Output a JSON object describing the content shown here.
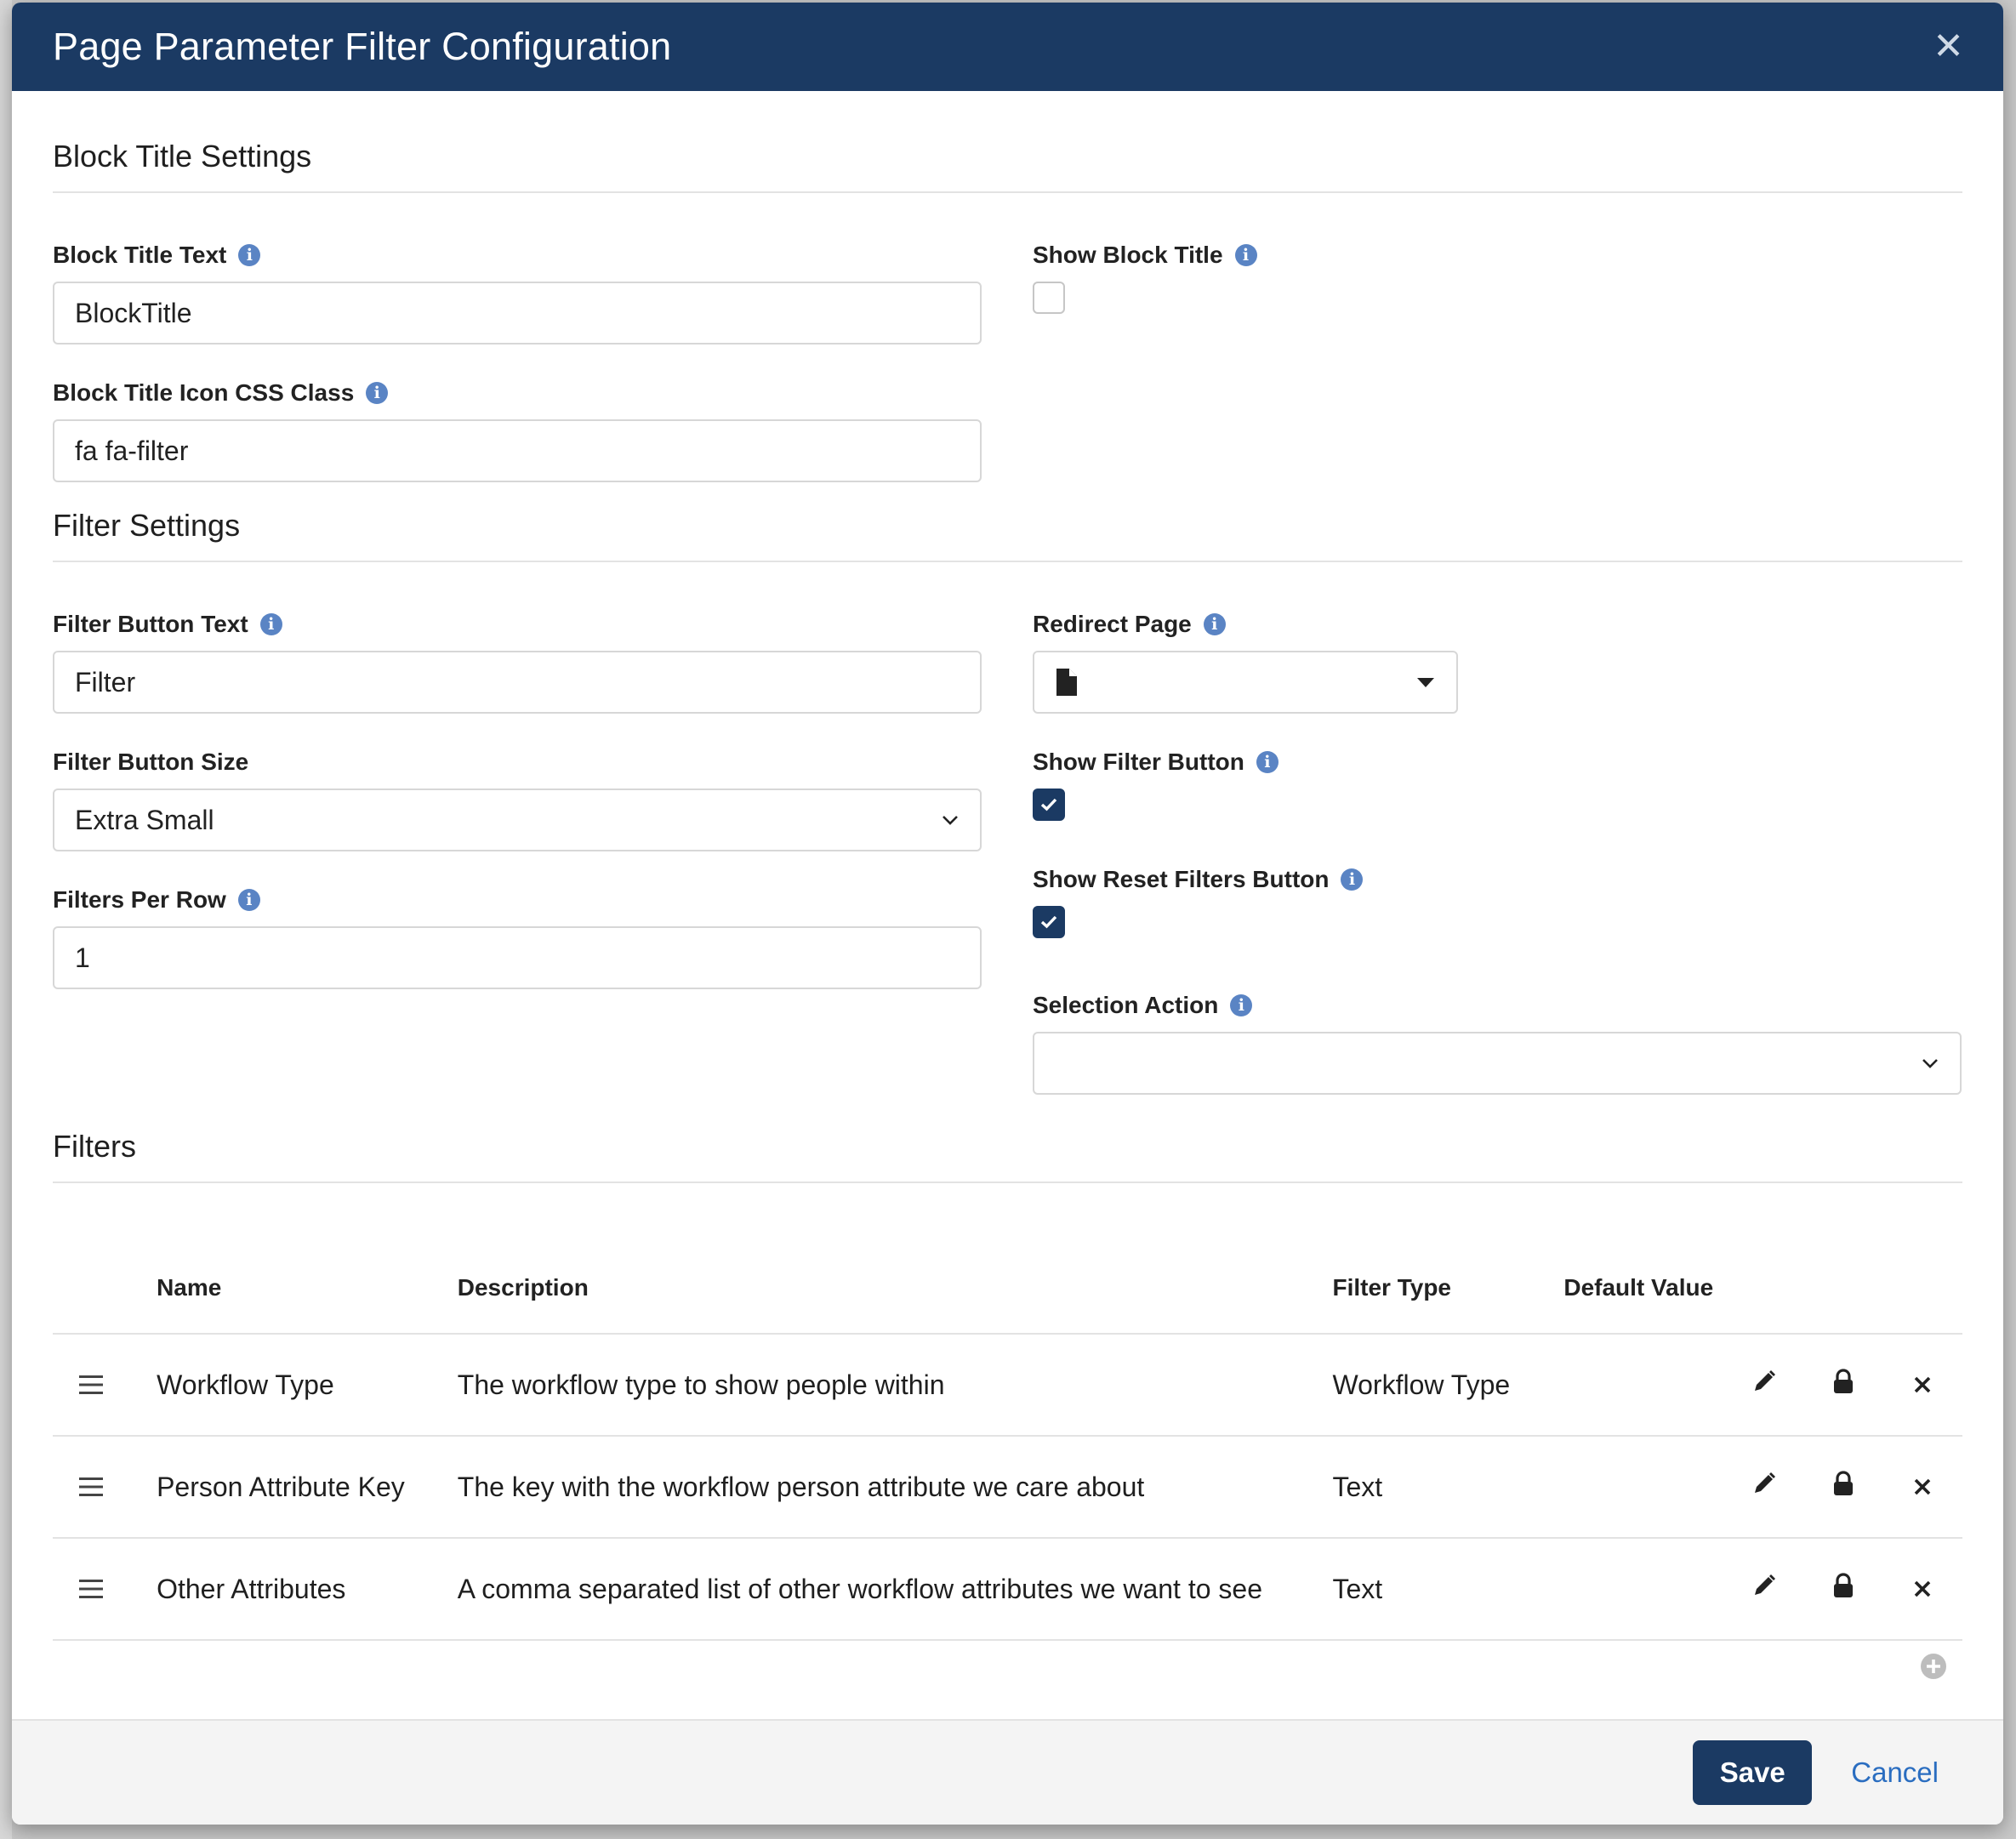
{
  "modal": {
    "title": "Page Parameter Filter Configuration",
    "close_icon": "close-icon"
  },
  "block_title_section": {
    "heading": "Block Title Settings",
    "title_text": {
      "label": "Block Title Text",
      "value": "BlockTitle"
    },
    "show_title": {
      "label": "Show Block Title",
      "checked": false
    },
    "icon_css": {
      "label": "Block Title Icon CSS Class",
      "value": "fa fa-filter"
    }
  },
  "filter_settings": {
    "heading": "Filter Settings",
    "button_text": {
      "label": "Filter Button Text",
      "value": "Filter"
    },
    "redirect_page": {
      "label": "Redirect Page",
      "value": ""
    },
    "button_size": {
      "label": "Filter Button Size",
      "value": "Extra Small"
    },
    "show_filter_button": {
      "label": "Show Filter Button",
      "checked": true
    },
    "per_row": {
      "label": "Filters Per Row",
      "value": "1"
    },
    "show_reset": {
      "label": "Show Reset Filters Button",
      "checked": true
    },
    "selection_action": {
      "label": "Selection Action",
      "value": ""
    }
  },
  "filters": {
    "heading": "Filters",
    "columns": [
      "Name",
      "Description",
      "Filter Type",
      "Default Value"
    ],
    "rows": [
      {
        "name": "Workflow Type",
        "description": "The workflow type to show people within",
        "type": "Workflow Type",
        "default": ""
      },
      {
        "name": "Person Attribute Key",
        "description": "The key with the workflow person attribute we care about",
        "type": "Text",
        "default": ""
      },
      {
        "name": "Other Attributes",
        "description": "A comma separated list of other workflow attributes we want to see",
        "type": "Text",
        "default": ""
      }
    ]
  },
  "footer": {
    "save_label": "Save",
    "cancel_label": "Cancel"
  },
  "colors": {
    "header": "#1b3a63",
    "accent": "#2a6dc0",
    "info": "#5a84c4"
  }
}
